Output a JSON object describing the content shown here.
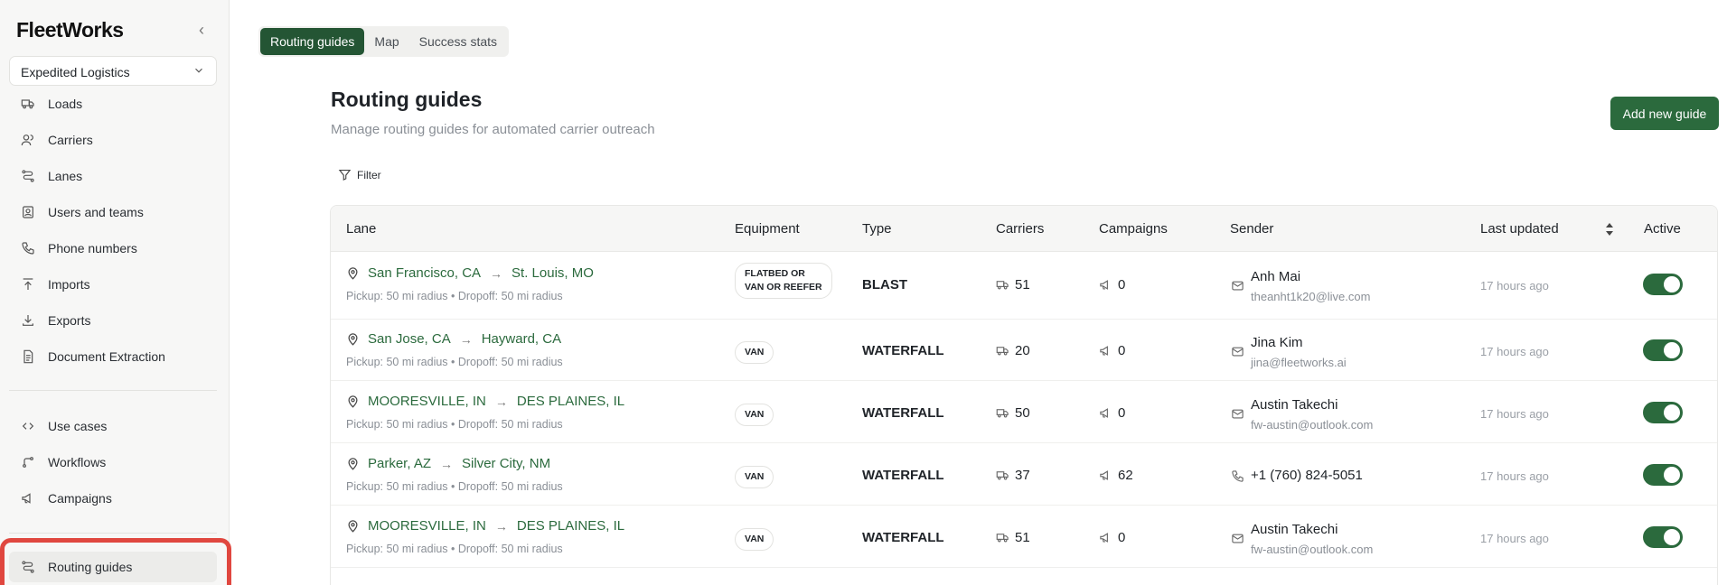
{
  "sidebar": {
    "logo": "FleetWorks",
    "org_select": "Expedited Logistics",
    "items": [
      {
        "label": "Loads",
        "icon": "truck-icon"
      },
      {
        "label": "Carriers",
        "icon": "users-icon"
      },
      {
        "label": "Lanes",
        "icon": "route-icon"
      },
      {
        "label": "Users and teams",
        "icon": "contact-icon"
      },
      {
        "label": "Phone numbers",
        "icon": "phone-icon"
      },
      {
        "label": "Imports",
        "icon": "upload-icon"
      },
      {
        "label": "Exports",
        "icon": "download-icon"
      },
      {
        "label": "Document Extraction",
        "icon": "document-icon"
      }
    ],
    "items2": [
      {
        "label": "Use cases",
        "icon": "code-icon"
      },
      {
        "label": "Workflows",
        "icon": "workflow-icon"
      },
      {
        "label": "Campaigns",
        "icon": "megaphone-icon"
      }
    ],
    "active_item": {
      "label": "Routing guides",
      "icon": "route-icon"
    }
  },
  "tabs": [
    "Routing guides",
    "Map",
    "Success stats"
  ],
  "header": {
    "title": "Routing guides",
    "subtitle": "Manage routing guides for automated carrier outreach",
    "add_button": "Add new guide",
    "filter": "Filter"
  },
  "table": {
    "columns": [
      "Lane",
      "Equipment",
      "Type",
      "Carriers",
      "Campaigns",
      "Sender",
      "Last updated",
      "Active"
    ],
    "rows": [
      {
        "origin": "San Francisco, CA",
        "destination": "St. Louis, MO",
        "radius": "Pickup: 50 mi radius • Dropoff: 50 mi radius",
        "equipment": "FLATBED OR VAN OR REEFER",
        "type": "BLAST",
        "carriers": "51",
        "campaigns": "0",
        "sender_type": "email",
        "sender_name": "Anh Mai",
        "sender_contact": "theanht1k20@live.com",
        "updated": "17 hours ago",
        "active": true
      },
      {
        "origin": "San Jose, CA",
        "destination": "Hayward, CA",
        "radius": "Pickup: 50 mi radius • Dropoff: 50 mi radius",
        "equipment": "VAN",
        "type": "WATERFALL",
        "carriers": "20",
        "campaigns": "0",
        "sender_type": "email",
        "sender_name": "Jina Kim",
        "sender_contact": "jina@fleetworks.ai",
        "updated": "17 hours ago",
        "active": true
      },
      {
        "origin": "MOORESVILLE, IN",
        "destination": "DES PLAINES, IL",
        "radius": "Pickup: 50 mi radius • Dropoff: 50 mi radius",
        "equipment": "VAN",
        "type": "WATERFALL",
        "carriers": "50",
        "campaigns": "0",
        "sender_type": "email",
        "sender_name": "Austin Takechi",
        "sender_contact": "fw-austin@outlook.com",
        "updated": "17 hours ago",
        "active": true
      },
      {
        "origin": "Parker, AZ",
        "destination": "Silver City, NM",
        "radius": "Pickup: 50 mi radius • Dropoff: 50 mi radius",
        "equipment": "VAN",
        "type": "WATERFALL",
        "carriers": "37",
        "campaigns": "62",
        "sender_type": "phone",
        "sender_name": "+1 (760) 824-5051",
        "sender_contact": "",
        "updated": "17 hours ago",
        "active": true
      },
      {
        "origin": "MOORESVILLE, IN",
        "destination": "DES PLAINES, IL",
        "radius": "Pickup: 50 mi radius • Dropoff: 50 mi radius",
        "equipment": "VAN",
        "type": "WATERFALL",
        "carriers": "51",
        "campaigns": "0",
        "sender_type": "email",
        "sender_name": "Austin Takechi",
        "sender_contact": "fw-austin@outlook.com",
        "updated": "17 hours ago",
        "active": true
      }
    ]
  },
  "colors": {
    "brand_green": "#2b6a3d",
    "tab_active": "#245534",
    "highlight_red": "#e0473f"
  }
}
